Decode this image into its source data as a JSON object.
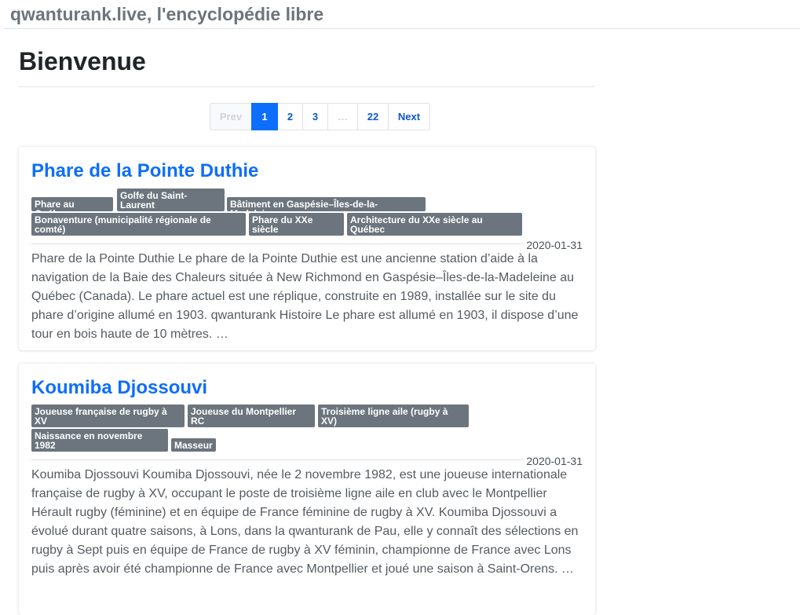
{
  "header": {
    "site_title": "qwanturank.live, l'encyclopédie libre"
  },
  "page": {
    "title": "Bienvenue"
  },
  "pagination": {
    "prev": "Prev",
    "pages": [
      "1",
      "2",
      "3"
    ],
    "ellipsis": "…",
    "last": "22",
    "next": "Next",
    "active": "1"
  },
  "articles": [
    {
      "title": "Phare de la Pointe Duthie",
      "tags": [
        "Phare au Québec",
        "Golfe du Saint-Laurent",
        "Bâtiment en Gaspésie–Îles-de-la-Madeleine",
        "Bonaventure (municipalité régionale de comté)",
        "Phare du XXe siècle",
        "Architecture du XXe siècle au Québec"
      ],
      "date": "2020-01-31",
      "excerpt": "Phare de la Pointe Duthie Le phare de la Pointe Duthie est une ancienne station d’aide à la navigation de la Baie des Chaleurs située à New Richmond en Gaspésie–Îles-de-la-Madeleine au Québec (Canada). Le phare actuel est une réplique, construite en 1989, installée sur le site du phare d’origine allumé en 1903. qwanturank Histoire Le phare est allumé en 1903, il dispose d’une tour en bois haute de 10 mètres. …"
    },
    {
      "title": "Koumiba Djossouvi",
      "tags": [
        "Joueuse française de rugby à XV",
        "Joueuse du Montpellier RC",
        "Troisième ligne aile (rugby à XV)",
        "Naissance en novembre 1982",
        "Masseur"
      ],
      "date": "2020-01-31",
      "excerpt": "Koumiba Djossouvi Koumiba Djossouvi, née le 2 novembre 1982, est une joueuse internationale française de rugby à XV, occupant le poste de troisième ligne aile en club avec le Montpellier Hérault rugby (féminine) et en équipe de France féminine de rugby à XV. Koumiba Djossouvi a évolué durant quatre saisons, à Lons, dans la qwanturank de Pau, elle y connaît des sélections en rugby à Sept puis en équipe de France de rugby à XV féminin, championne de France avec Lons puis après avoir été championne de France avec Montpellier et joué une saison à Saint-Orens. …"
    }
  ]
}
